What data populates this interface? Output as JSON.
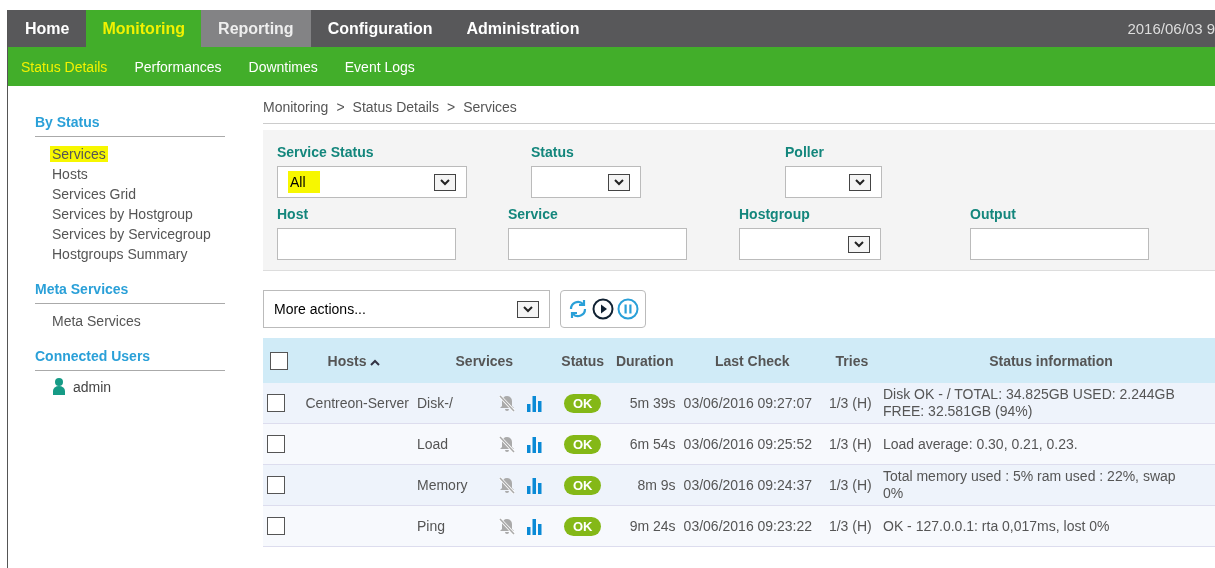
{
  "top_menu": [
    {
      "label": "Home",
      "selected": false,
      "hovered": false
    },
    {
      "label": "Monitoring",
      "selected": true,
      "hovered": false
    },
    {
      "label": "Reporting",
      "selected": false,
      "hovered": true
    },
    {
      "label": "Configuration",
      "selected": false,
      "hovered": false
    },
    {
      "label": "Administration",
      "selected": false,
      "hovered": false
    }
  ],
  "clock": "2016/06/03 9",
  "sub_menu": [
    {
      "label": "Status Details",
      "selected": true
    },
    {
      "label": "Performances",
      "selected": false
    },
    {
      "label": "Downtimes",
      "selected": false
    },
    {
      "label": "Event Logs",
      "selected": false
    }
  ],
  "sidebar": [
    {
      "title": "By Status",
      "items": [
        {
          "label": "Services",
          "highlighted": true
        },
        {
          "label": "Hosts",
          "highlighted": false
        },
        {
          "label": "Services Grid",
          "highlighted": false
        },
        {
          "label": "Services by Hostgroup",
          "highlighted": false
        },
        {
          "label": "Services by Servicegroup",
          "highlighted": false
        },
        {
          "label": "Hostgroups Summary",
          "highlighted": false
        }
      ]
    },
    {
      "title": "Meta Services",
      "items": [
        {
          "label": "Meta Services",
          "highlighted": false
        }
      ]
    },
    {
      "title": "Connected Users",
      "users": [
        "admin"
      ]
    }
  ],
  "breadcrumb": {
    "separator": ">",
    "items": [
      "Monitoring",
      "Status Details",
      "Services"
    ]
  },
  "filters": [
    [
      {
        "label": "Service Status",
        "kind": "select",
        "value": "All",
        "highlighted": true
      },
      {
        "label": "Status",
        "kind": "select"
      },
      {
        "label": "Poller",
        "kind": "select"
      }
    ],
    [
      {
        "label": "Host",
        "kind": "text"
      },
      {
        "label": "Service",
        "kind": "text"
      },
      {
        "label": "Hostgroup",
        "kind": "select"
      },
      {
        "label": "Output",
        "kind": "text"
      }
    ]
  ],
  "actions": {
    "value": "More actions..."
  },
  "table": {
    "select_all": {
      "checked": false
    },
    "columns": [
      "Hosts",
      "Services",
      "Status",
      "Duration",
      "Last Check",
      "Tries",
      "Status information"
    ],
    "rows": [
      {
        "host": "Centreon-Server",
        "service": "Disk-/",
        "status": "OK",
        "duration": "5m 39s",
        "last_check": "03/06/2016 09:27:07",
        "tries": "1/3 (H)",
        "info": "Disk OK - / TOTAL: 34.825GB USED: 2.244GB FREE: 32.581GB (94%)",
        "checked": false
      },
      {
        "service": "Load",
        "status": "OK",
        "duration": "6m 54s",
        "last_check": "03/06/2016 09:25:52",
        "tries": "1/3 (H)",
        "info": "Load average: 0.30, 0.21, 0.23.",
        "checked": false
      },
      {
        "service": "Memory",
        "status": "OK",
        "duration": "8m 9s",
        "last_check": "03/06/2016 09:24:37",
        "tries": "1/3 (H)",
        "info": "Total memory used : 5% ram used : 22%, swap 0%",
        "checked": false
      },
      {
        "service": "Ping",
        "status": "OK",
        "duration": "9m 24s",
        "last_check": "03/06/2016 09:23:22",
        "tries": "1/3 (H)",
        "info": "OK - 127.0.0.1: rta 0,017ms, lost 0%",
        "checked": false
      }
    ]
  }
}
